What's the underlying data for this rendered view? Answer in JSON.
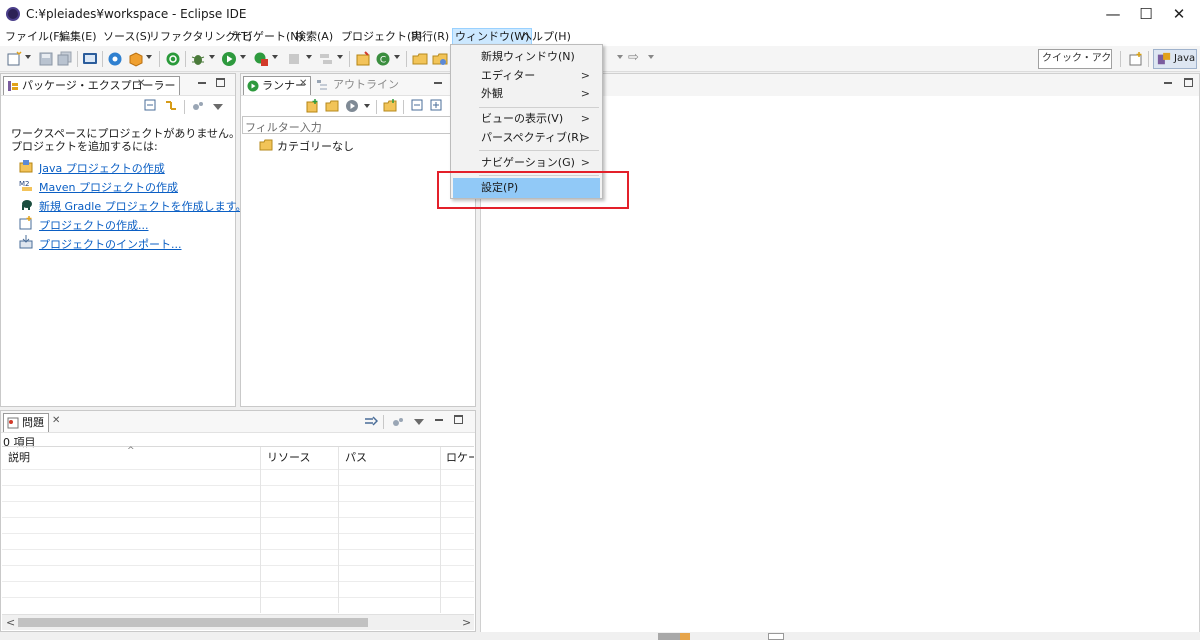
{
  "window": {
    "title": "C:¥pleiades¥workspace - Eclipse IDE",
    "controls": {
      "minimize": "—",
      "maximize": "☐",
      "close": "✕"
    }
  },
  "menubar": {
    "items": [
      "ファイル(F)",
      "編集(E)",
      "ソース(S)",
      "リファクタリング(T)",
      "ナビゲート(N)",
      "検索(A)",
      "プロジェクト(P)",
      "実行(R)",
      "ウィンドウ(W)",
      "ヘルプ(H)"
    ],
    "active_index": 8
  },
  "toolbar": {
    "quick_access": "クイック・アクセス",
    "perspective_label": "Java"
  },
  "package_explorer": {
    "tab_label": "パッケージ・エクスプローラー",
    "message_line1": "ワークスペースにプロジェクトがありません。",
    "message_line2": "プロジェクトを追加するには:",
    "links": [
      "Java プロジェクトの作成",
      "Maven プロジェクトの作成",
      "新規 Gradle プロジェクトを作成します。",
      "プロジェクトの作成...",
      "プロジェクトのインポート..."
    ]
  },
  "runner": {
    "tab_label": "ランナー",
    "outline_tab_label": "アウトライン",
    "filter_placeholder": "フィルター入力",
    "tree_item": "カテゴリーなし"
  },
  "problems": {
    "tab_label": "問題",
    "item_count": "0 項目",
    "columns": [
      "説明",
      "リソース",
      "パス",
      "ロケーシ"
    ]
  },
  "window_menu": {
    "items": [
      {
        "label": "新規ウィンドウ(N)",
        "submenu": false
      },
      {
        "label": "エディター",
        "submenu": true
      },
      {
        "label": "外観",
        "submenu": true
      },
      {
        "label": "ビューの表示(V)",
        "submenu": true
      },
      {
        "label": "パースペクティブ(R)",
        "submenu": true
      },
      {
        "label": "ナビゲーション(G)",
        "submenu": true
      },
      {
        "label": "設定(P)",
        "submenu": false,
        "highlighted": true
      }
    ],
    "submenu_arrow": ">"
  },
  "colors": {
    "highlight_box": "#e3202a",
    "menu_selected": "#91c9f7",
    "link": "#0b5fc4"
  }
}
